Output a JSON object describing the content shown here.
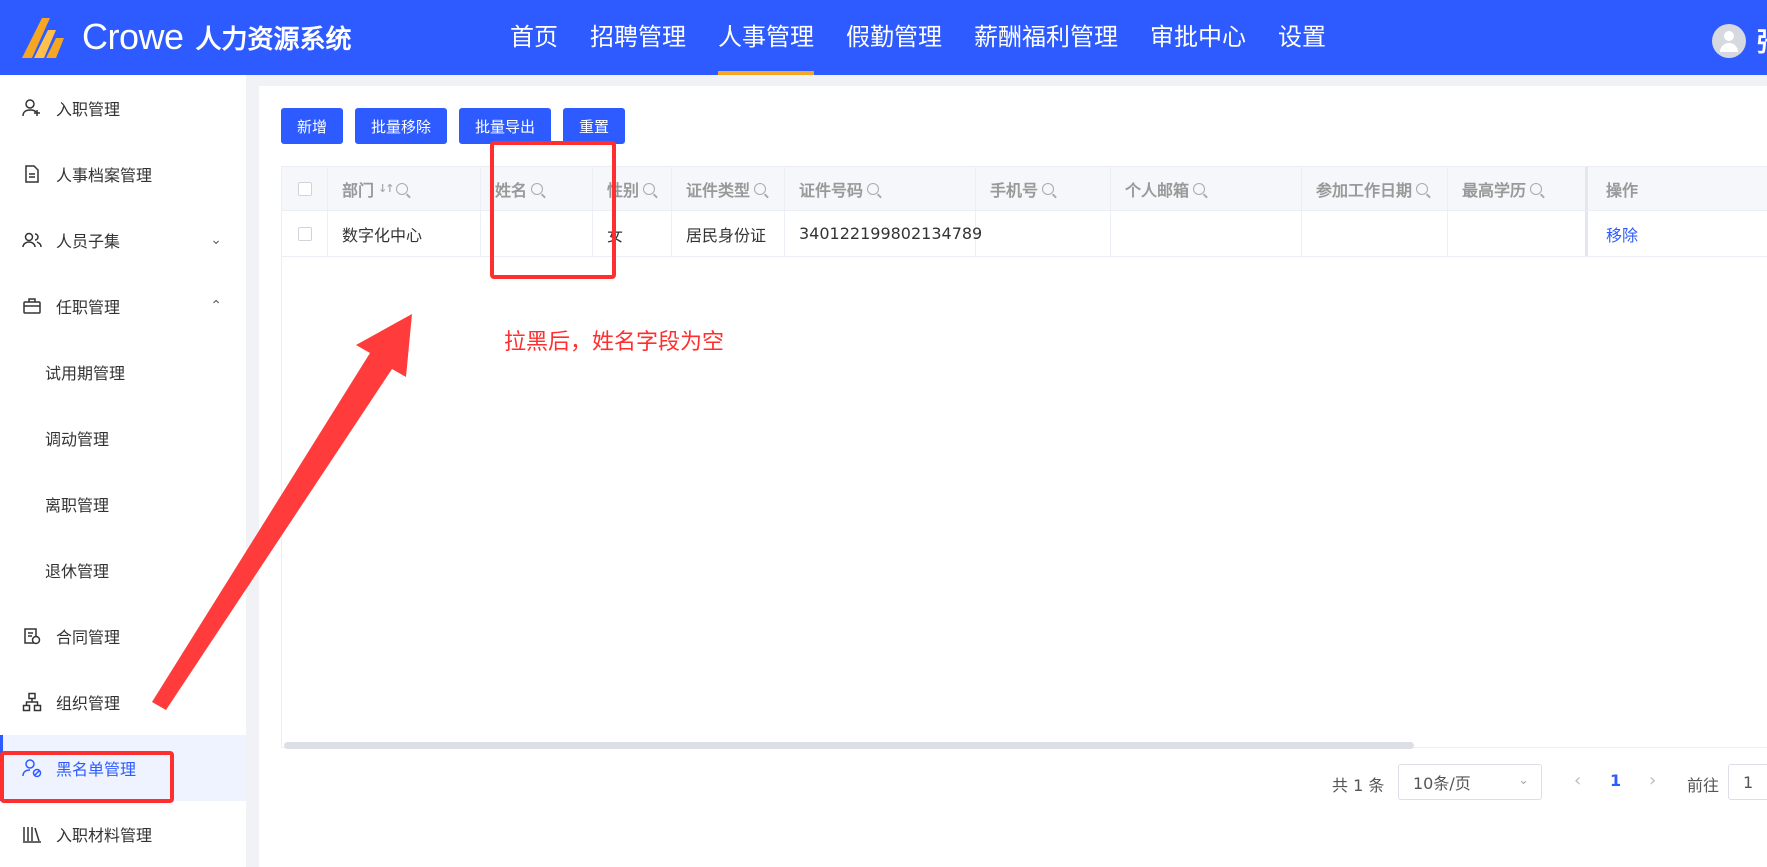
{
  "app": {
    "brand": "Crowe",
    "system_name": "人力资源系统",
    "user_initial": "张"
  },
  "topnav": [
    {
      "label": "首页"
    },
    {
      "label": "招聘管理"
    },
    {
      "label": "人事管理",
      "active": true
    },
    {
      "label": "假勤管理"
    },
    {
      "label": "薪酬福利管理"
    },
    {
      "label": "审批中心"
    },
    {
      "label": "设置"
    }
  ],
  "sidebar": {
    "items": [
      {
        "label": "入职管理",
        "icon": "user-add-icon"
      },
      {
        "label": "人事档案管理",
        "icon": "document-icon"
      },
      {
        "label": "人员子集",
        "icon": "users-icon",
        "arrow": "⌄"
      },
      {
        "label": "任职管理",
        "icon": "briefcase-icon",
        "arrow": "⌃"
      },
      {
        "label": "试用期管理"
      },
      {
        "label": "调动管理"
      },
      {
        "label": "离职管理"
      },
      {
        "label": "退休管理"
      },
      {
        "label": "合同管理",
        "icon": "contract-icon"
      },
      {
        "label": "组织管理",
        "icon": "org-chart-icon"
      },
      {
        "label": "黑名单管理",
        "icon": "user-block-icon",
        "active": true
      },
      {
        "label": "入职材料管理",
        "icon": "books-icon"
      }
    ]
  },
  "toolbar": {
    "add_label": "新增",
    "batch_remove_label": "批量移除",
    "batch_export_label": "批量导出",
    "reset_label": "重置"
  },
  "table": {
    "columns": [
      "部门",
      "姓名",
      "性别",
      "证件类型",
      "证件号码",
      "手机号",
      "个人邮箱",
      "参加工作日期",
      "最高学历",
      "操作"
    ],
    "rows": [
      {
        "dept": "数字化中心",
        "name": "",
        "gender": "女",
        "id_type": "居民身份证",
        "id_no": "340122199802134789",
        "phone": "",
        "email": "",
        "work_date": "",
        "education": "",
        "action": "移除"
      }
    ]
  },
  "pagination": {
    "total": "共 1 条",
    "page_size": "10条/页",
    "current_page": "1",
    "goto_label": "前往",
    "goto_value": "1"
  },
  "annotation": {
    "text": "拉黑后，姓名字段为空",
    "color": "#ff2f2f"
  },
  "colors": {
    "primary": "#2e5bff",
    "accent": "#f5a623"
  }
}
